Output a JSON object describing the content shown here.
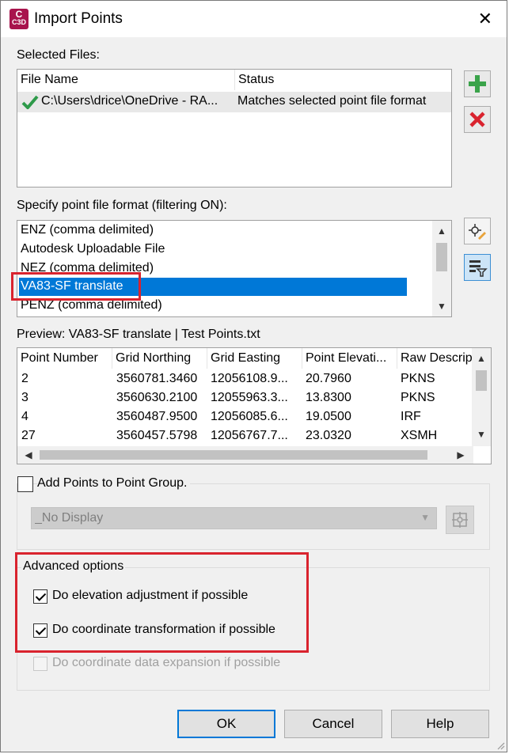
{
  "window": {
    "title": "Import Points",
    "app_icon_text": "C",
    "app_icon_subtext": "C3D"
  },
  "selected_files": {
    "label": "Selected Files:",
    "columns": [
      "File Name",
      "Status"
    ],
    "rows": [
      {
        "file": "C:\\Users\\drice\\OneDrive - RA...",
        "status": "Matches selected point file format"
      }
    ]
  },
  "format": {
    "label": "Specify point file format (filtering ON):",
    "items": [
      "ENZ (comma delimited)",
      "Autodesk Uploadable File",
      "NEZ (comma delimited)",
      "VA83-SF translate",
      "PENZ (comma delimited)"
    ],
    "selected": "VA83-SF translate"
  },
  "preview": {
    "label": "Preview: VA83-SF translate | Test Points.txt",
    "columns": [
      "Point Number",
      "Grid Northing",
      "Grid Easting",
      "Point Elevati...",
      "Raw Descrip"
    ],
    "rows": [
      [
        "2",
        "3560781.3460",
        "12056108.9...",
        "20.7960",
        "PKNS"
      ],
      [
        "3",
        "3560630.2100",
        "12055963.3...",
        "13.8300",
        "PKNS"
      ],
      [
        "4",
        "3560487.9500",
        "12056085.6...",
        "19.0500",
        "IRF"
      ],
      [
        "27",
        "3560457.5798",
        "12056767.7...",
        "23.0320",
        "XSMH"
      ]
    ]
  },
  "point_group": {
    "label": "Add Points to Point Group.",
    "checked": false,
    "dropdown_value": "_No Display"
  },
  "advanced": {
    "label": "Advanced options",
    "options": [
      {
        "label": "Do elevation adjustment if possible",
        "checked": true,
        "enabled": true
      },
      {
        "label": "Do coordinate transformation if possible",
        "checked": true,
        "enabled": true
      },
      {
        "label": "Do coordinate data expansion if possible",
        "checked": false,
        "enabled": false
      }
    ]
  },
  "buttons": {
    "ok": "OK",
    "cancel": "Cancel",
    "help": "Help"
  },
  "colors": {
    "selection": "#0078d7",
    "highlight_box": "#d9232e",
    "add_icon": "#3aa34a",
    "remove_icon": "#d9232e",
    "app_icon": "#a8144d"
  }
}
